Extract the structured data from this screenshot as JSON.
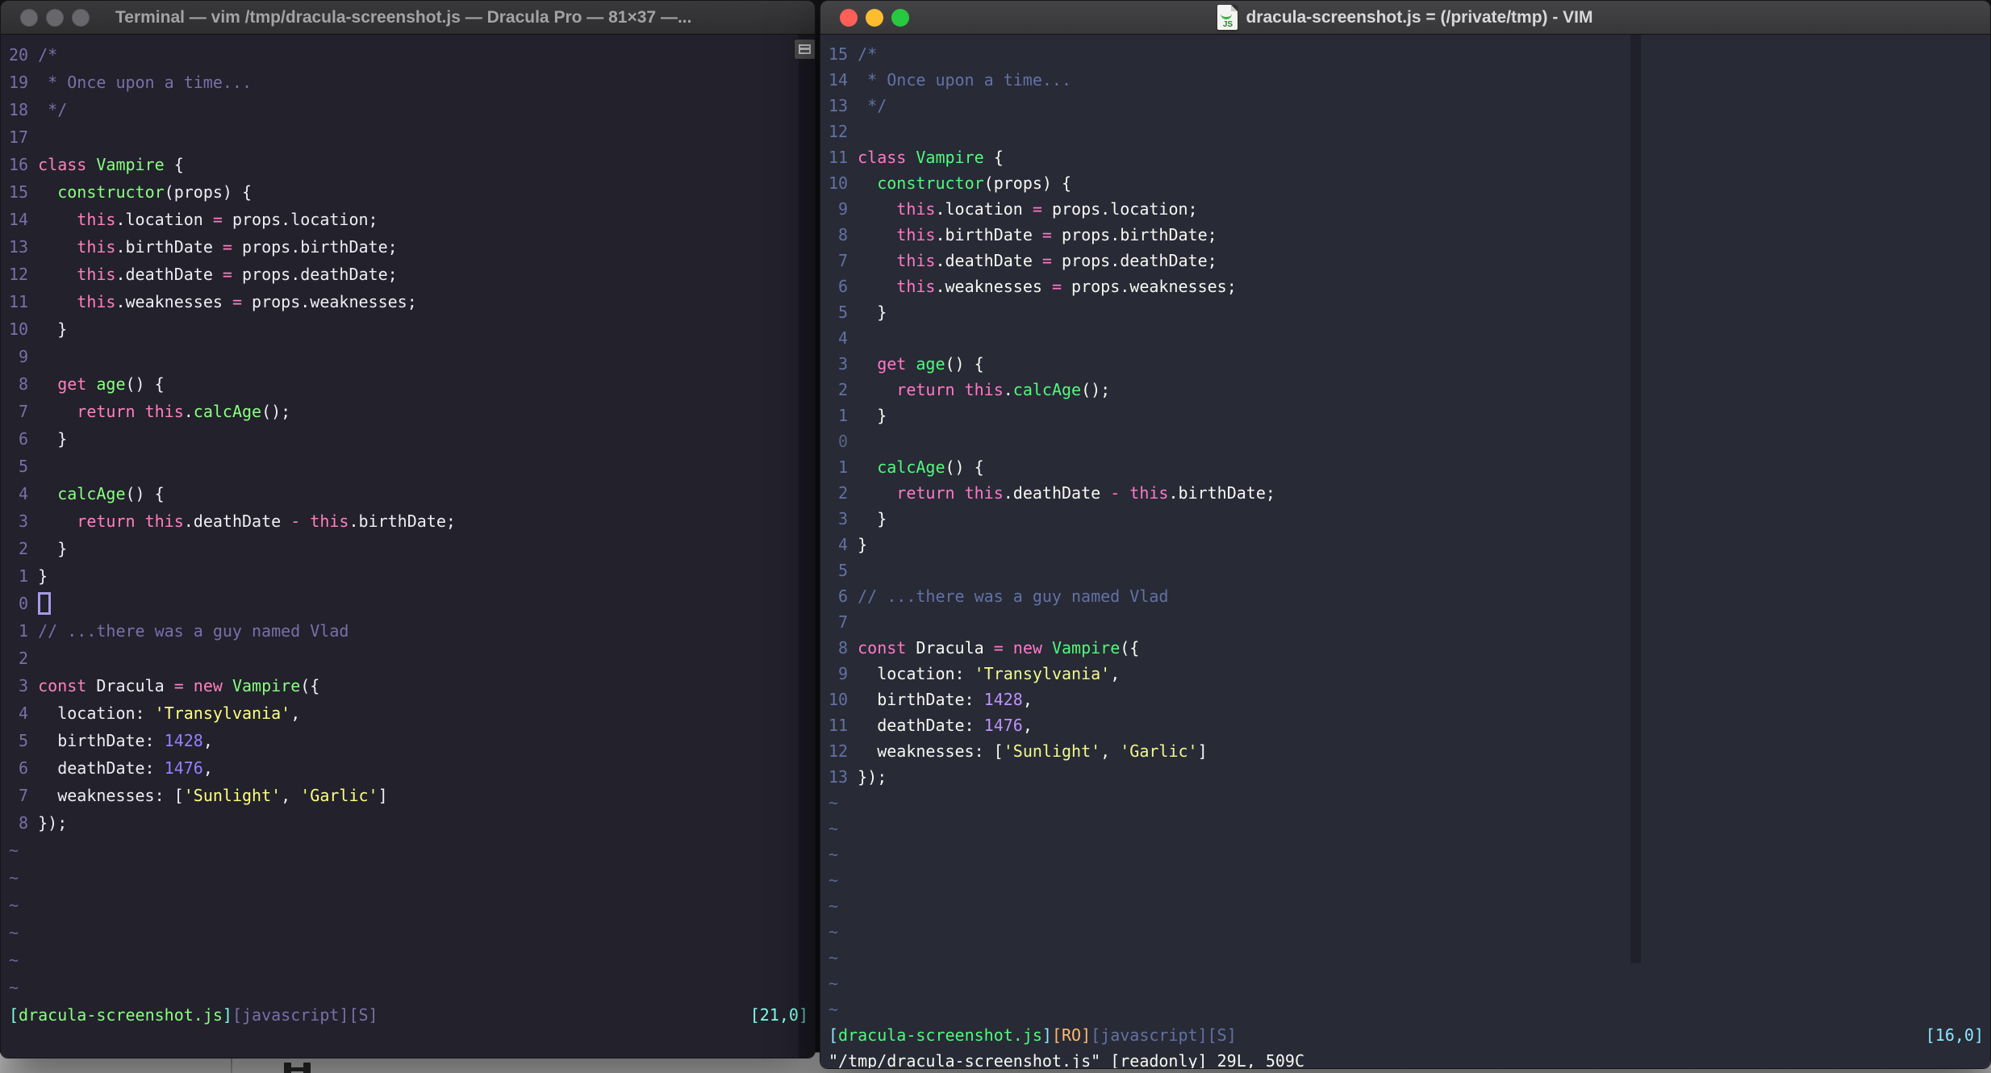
{
  "colors": {
    "traffic_red": "#ff5f57",
    "traffic_yellow": "#febc2e",
    "traffic_green": "#28c840",
    "traffic_inactive": "#68686c"
  },
  "code": [
    [
      [
        "/*",
        "c"
      ]
    ],
    [
      [
        " * Once upon a time...",
        "c"
      ]
    ],
    [
      [
        " */",
        "c"
      ]
    ],
    [],
    [
      [
        "class",
        "p"
      ],
      [
        " ",
        "f"
      ],
      [
        "Vampire",
        "g"
      ],
      [
        " {",
        "f"
      ]
    ],
    [
      [
        "  ",
        "f"
      ],
      [
        "constructor",
        "g"
      ],
      [
        "(props) {",
        "f"
      ]
    ],
    [
      [
        "    ",
        "f"
      ],
      [
        "this",
        "p"
      ],
      [
        ".location ",
        "f"
      ],
      [
        "=",
        "p"
      ],
      [
        " props.location;",
        "f"
      ]
    ],
    [
      [
        "    ",
        "f"
      ],
      [
        "this",
        "p"
      ],
      [
        ".birthDate ",
        "f"
      ],
      [
        "=",
        "p"
      ],
      [
        " props.birthDate;",
        "f"
      ]
    ],
    [
      [
        "    ",
        "f"
      ],
      [
        "this",
        "p"
      ],
      [
        ".deathDate ",
        "f"
      ],
      [
        "=",
        "p"
      ],
      [
        " props.deathDate;",
        "f"
      ]
    ],
    [
      [
        "    ",
        "f"
      ],
      [
        "this",
        "p"
      ],
      [
        ".weaknesses ",
        "f"
      ],
      [
        "=",
        "p"
      ],
      [
        " props.weaknesses;",
        "f"
      ]
    ],
    [
      [
        "  }",
        "f"
      ]
    ],
    [],
    [
      [
        "  ",
        "f"
      ],
      [
        "get",
        "p"
      ],
      [
        " ",
        "f"
      ],
      [
        "age",
        "g"
      ],
      [
        "() {",
        "f"
      ]
    ],
    [
      [
        "    ",
        "f"
      ],
      [
        "return",
        "p"
      ],
      [
        " ",
        "f"
      ],
      [
        "this",
        "p"
      ],
      [
        ".",
        "f"
      ],
      [
        "calcAge",
        "g"
      ],
      [
        "();",
        "f"
      ]
    ],
    [
      [
        "  }",
        "f"
      ]
    ],
    [],
    [
      [
        "  ",
        "f"
      ],
      [
        "calcAge",
        "g"
      ],
      [
        "() {",
        "f"
      ]
    ],
    [
      [
        "    ",
        "f"
      ],
      [
        "return",
        "p"
      ],
      [
        " ",
        "f"
      ],
      [
        "this",
        "p"
      ],
      [
        ".deathDate ",
        "f"
      ],
      [
        "-",
        "p"
      ],
      [
        " ",
        "f"
      ],
      [
        "this",
        "p"
      ],
      [
        ".birthDate;",
        "f"
      ]
    ],
    [
      [
        "  }",
        "f"
      ]
    ],
    [
      [
        "}",
        "f"
      ]
    ],
    [],
    [
      [
        "// ...there was a guy named Vlad",
        "c"
      ]
    ],
    [],
    [
      [
        "const",
        "p"
      ],
      [
        " Dracula ",
        "f"
      ],
      [
        "=",
        "p"
      ],
      [
        " ",
        "f"
      ],
      [
        "new",
        "p"
      ],
      [
        " ",
        "f"
      ],
      [
        "Vampire",
        "g"
      ],
      [
        "({",
        "f"
      ]
    ],
    [
      [
        "  location: ",
        "f"
      ],
      [
        "'Transylvania'",
        "y"
      ],
      [
        ",",
        "f"
      ]
    ],
    [
      [
        "  birthDate: ",
        "f"
      ],
      [
        "1428",
        "u"
      ],
      [
        ",",
        "f"
      ]
    ],
    [
      [
        "  deathDate: ",
        "f"
      ],
      [
        "1476",
        "u"
      ],
      [
        ",",
        "f"
      ]
    ],
    [
      [
        "  weaknesses: [",
        "f"
      ],
      [
        "'Sunlight'",
        "y"
      ],
      [
        ", ",
        "f"
      ],
      [
        "'Garlic'",
        "y"
      ],
      [
        "]",
        "f"
      ]
    ],
    [
      [
        "});",
        "f"
      ]
    ]
  ],
  "windows": {
    "left": {
      "title": "Terminal — vim /tmp/dracula-screenshot.js — Dracula Pro — 81×37 —...",
      "active": false,
      "numbers": [
        "20",
        "19",
        "18",
        "17",
        "16",
        "15",
        "14",
        "13",
        "12",
        "11",
        "10",
        "9",
        "8",
        "7",
        "6",
        "5",
        "4",
        "3",
        "2",
        "1",
        "0",
        "1",
        "2",
        "3",
        "4",
        "5",
        "6",
        "7",
        "8"
      ],
      "cursor_row": 20,
      "cursor_style": "hollow",
      "tildes": 6,
      "status_left": [
        [
          "[",
          "cy"
        ],
        [
          "dracula-screenshot.js",
          "g"
        ],
        [
          "]",
          "cy"
        ],
        [
          "[javascript][S]",
          "c"
        ]
      ],
      "status_right": [
        [
          "[21,0]",
          "cy"
        ]
      ],
      "cmdline": "",
      "palette": {
        "bg": "#22212c",
        "fg": "#eeeef6",
        "pink": "#ff80bf",
        "green": "#8aff80",
        "yellow": "#ffff80",
        "purple": "#9580ff",
        "comment": "#7970a9",
        "cyan": "#80ffea",
        "orange": "#ffca80",
        "lnr": "#7970a9",
        "lnrcur": "#7970a9"
      }
    },
    "right": {
      "title": "dracula-screenshot.js = (/private/tmp) - VIM",
      "active": true,
      "numbers": [
        "15",
        "14",
        "13",
        "12",
        "11",
        "10",
        "9",
        "8",
        "7",
        "6",
        "5",
        "4",
        "3",
        "2",
        "1",
        "0",
        "1",
        "2",
        "3",
        "4",
        "5",
        "6",
        "7",
        "8",
        "9",
        "10",
        "11",
        "12",
        "13"
      ],
      "cursor_row": 15,
      "cursor_style": "none",
      "tildes": 9,
      "status_left": [
        [
          "[",
          "cy"
        ],
        [
          "dracula-screenshot.js",
          "g"
        ],
        [
          "]",
          "cy"
        ],
        [
          "[RO]",
          "o"
        ],
        [
          "[javascript][S]",
          "c"
        ]
      ],
      "status_right": [
        [
          "[16,0]",
          "cy"
        ]
      ],
      "cmdline": "\"/tmp/dracula-screenshot.js\" [readonly] 29L, 509C",
      "palette": {
        "bg": "#282a36",
        "fg": "#f8f8f2",
        "pink": "#ff79c6",
        "green": "#50fa7b",
        "yellow": "#f1fa8c",
        "purple": "#bd93f9",
        "comment": "#6272a4",
        "cyan": "#8be9fd",
        "orange": "#ffb86c",
        "lnr": "#6272a4",
        "lnrcur": "#5a6384"
      }
    }
  }
}
